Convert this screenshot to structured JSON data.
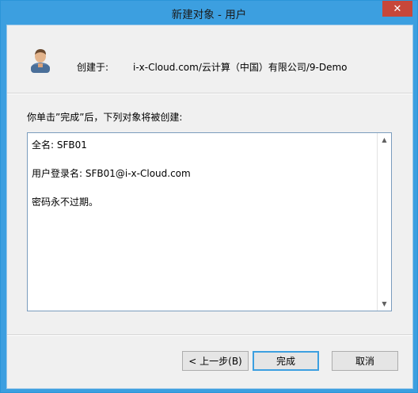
{
  "window": {
    "title": "新建对象 - 用户",
    "close_label": "✕"
  },
  "header": {
    "icon": "user-icon",
    "created_label": "创建于:",
    "created_path": "i-x-Cloud.com/云计算（中国）有限公司/9-Demo"
  },
  "instruction": "你单击”完成”后，下列对象将被创建:",
  "summary": {
    "lines": [
      "全名: SFB01",
      "用户登录名: SFB01@i-x-Cloud.com",
      "密码永不过期。"
    ]
  },
  "buttons": {
    "back": "< 上一步(B)",
    "finish": "完成",
    "cancel": "取消"
  },
  "colors": {
    "accent": "#3c9fe0",
    "close": "#c7473a",
    "client_bg": "#f0f0f0"
  }
}
